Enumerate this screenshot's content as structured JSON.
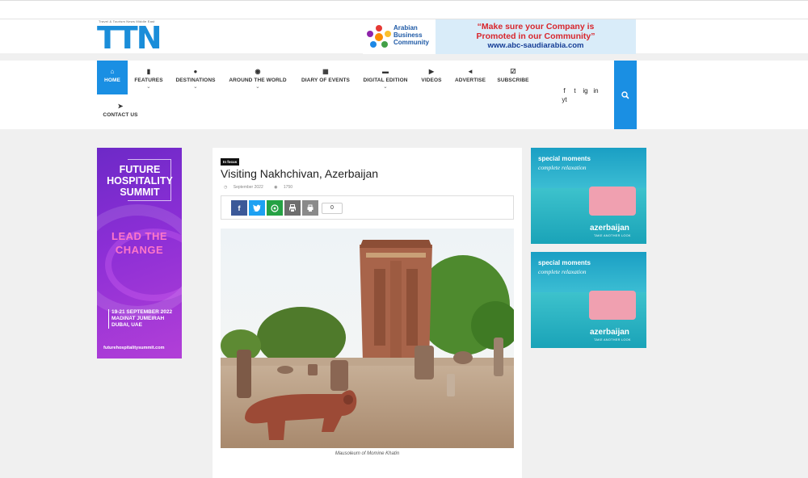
{
  "logo": {
    "letters": "TTN",
    "tagline": "Travel & Tourism News Middle East"
  },
  "banner": {
    "abc_name": "Arabian Business Community",
    "line1": "“Make sure your Company is",
    "line2": "Promoted in our Community”",
    "line3": "www.abc-saudiarabia.com"
  },
  "nav": {
    "items": [
      {
        "label": "HOME",
        "icon": "home-icon",
        "glyph": "⌂"
      },
      {
        "label": "FEATURES",
        "icon": "bookmark-icon",
        "glyph": "▮"
      },
      {
        "label": "DESTINATIONS",
        "icon": "map-pin-icon",
        "glyph": "●"
      },
      {
        "label": "AROUND THE WORLD",
        "icon": "globe-icon",
        "glyph": "◉"
      },
      {
        "label": "DIARY OF EVENTS",
        "icon": "calendar-icon",
        "glyph": "▦"
      },
      {
        "label": "DIGITAL EDITION",
        "icon": "folder-icon",
        "glyph": "▬"
      },
      {
        "label": "VIDEOS",
        "icon": "video-icon",
        "glyph": "▶"
      },
      {
        "label": "ADVERTISE",
        "icon": "megaphone-icon",
        "glyph": "◄"
      },
      {
        "label": "SUBSCRIBE",
        "icon": "checkbox-icon",
        "glyph": "☑"
      },
      {
        "label": "CONTACT US",
        "icon": "paper-plane-icon",
        "glyph": "➤"
      }
    ],
    "socials": [
      "f",
      "t",
      "ig",
      "in",
      "yt"
    ]
  },
  "left_ad": {
    "title": "FUTURE HOSPITALITY SUMMIT",
    "lead": "LEAD THE CHANGE",
    "dates": "19-21 SEPTEMBER 2022 MADINAT JUMEIRAH DUBAI, UAE",
    "url": "futurehospitalitysummit.com"
  },
  "article": {
    "badge": "In focus",
    "title": "Visiting Nakhchivan, Azerbaijan",
    "date": "September 2022",
    "views": "1750",
    "share_count": "0",
    "caption": "Mausoleum of Momine Khatin"
  },
  "right_ads": [
    {
      "line1": "special moments",
      "line2": "complete relaxation",
      "brand": "azerbaijan",
      "tagline": "TAKE ANOTHER LOOK"
    },
    {
      "line1": "special moments",
      "line2": "complete relaxation",
      "brand": "azerbaijan",
      "tagline": "TAKE ANOTHER LOOK"
    }
  ],
  "colors": {
    "accent": "#1a8fe3",
    "facebook": "#3b5998",
    "twitter": "#1da1f2",
    "whatsapp": "#25a244",
    "print": "#777777"
  }
}
